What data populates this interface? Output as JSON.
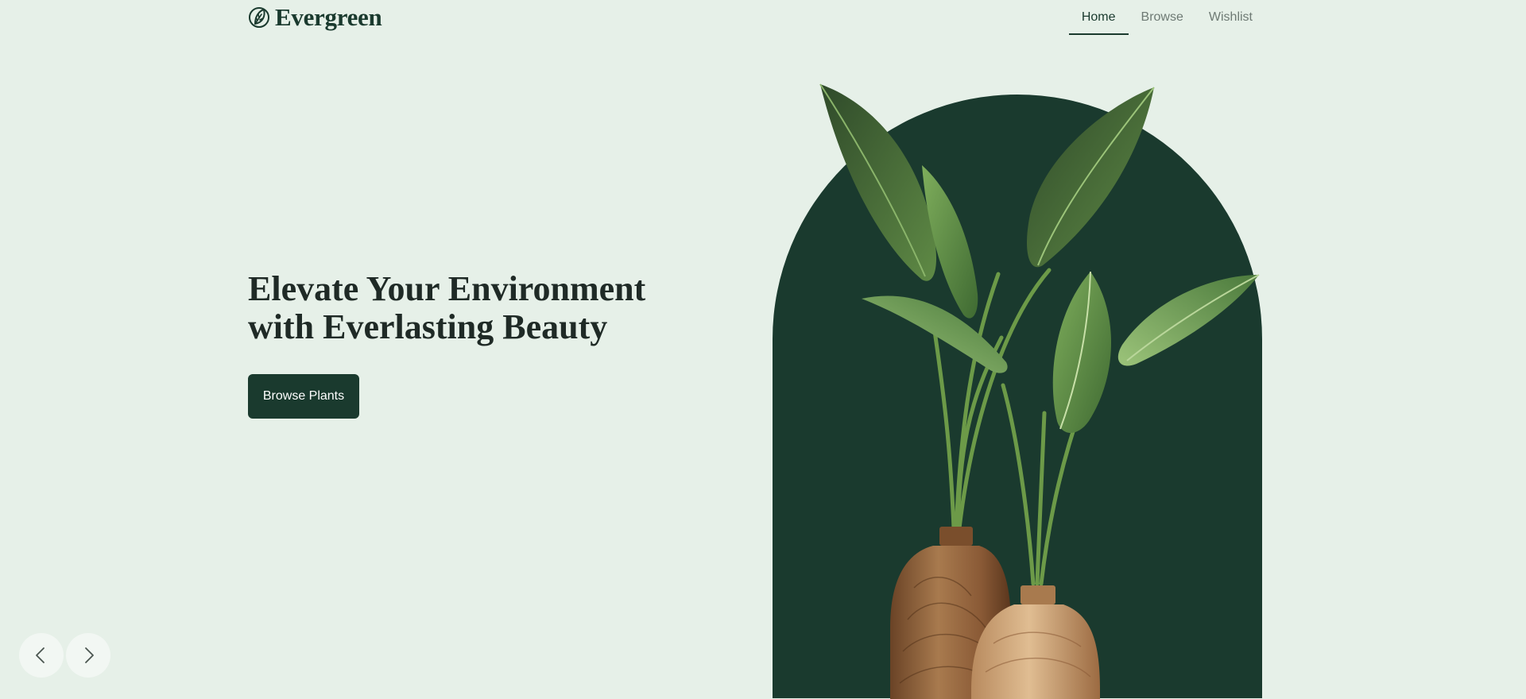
{
  "brand": {
    "name": "Evergreen",
    "icon": "leaf-icon"
  },
  "nav": {
    "items": [
      {
        "label": "Home",
        "active": true
      },
      {
        "label": "Browse",
        "active": false
      },
      {
        "label": "Wishlist",
        "active": false
      }
    ]
  },
  "hero": {
    "title_line1": "Elevate Your Environment",
    "title_line2": "with Everlasting Beauty",
    "cta_label": "Browse Plants",
    "image": "potted-plants-in-wooden-vases"
  },
  "carousel": {
    "prev_icon": "chevron-left-icon",
    "next_icon": "chevron-right-icon"
  },
  "colors": {
    "background": "#e6f0e8",
    "primary": "#1a3a2e",
    "text": "#1f2a26",
    "nav_muted": "#6e7a74",
    "carousel_button": "#f2f7f3"
  }
}
